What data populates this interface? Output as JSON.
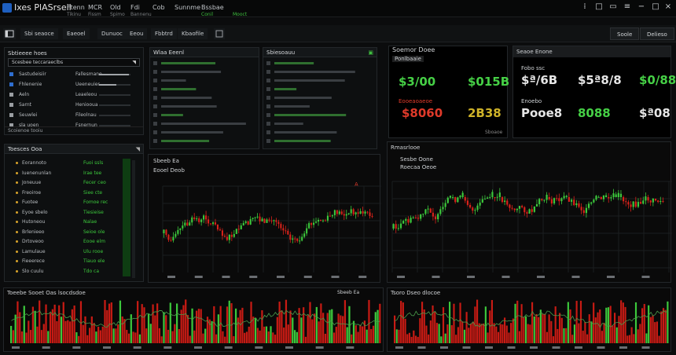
{
  "window": {
    "title": "Ixes PlASrseil",
    "menus": [
      "Ftenn",
      "MCR",
      "Old"
    ],
    "menus2": [
      "Fdi",
      "Cob",
      "Sunnme",
      "Bssbae"
    ],
    "sub": [
      "Tikinu",
      "Fissm",
      "Spimo",
      "Bannenu"
    ],
    "status": [
      "Conil",
      "Mooct"
    ]
  },
  "toolbar": {
    "items": [
      "Sbi seaoce",
      "Eaeoel",
      "Dunuoc",
      "Eeou",
      "Fbbtrd",
      "Kbaofile"
    ],
    "right": [
      "Soole",
      "Delieso"
    ]
  },
  "watchlist": {
    "title": "Sbtieeee hoes",
    "header": "Scesbee teccaraeclbs",
    "rows": [
      {
        "label": "Sastudeisiir",
        "value": "Fallesmane",
        "fill": 0.95
      },
      {
        "label": "Fhlenenie",
        "value": "Ueeneuier",
        "fill": 0.55
      },
      {
        "label": "Aeln",
        "value": "Leaeleou",
        "fill": 0.0
      },
      {
        "label": "Sarnt",
        "value": "Heniooua",
        "fill": 0.0
      },
      {
        "label": "Seuwlei",
        "value": "Fileolnau",
        "fill": 0.0
      },
      {
        "label": "sla uoen",
        "value": "Fsnernun",
        "fill": 0.0
      }
    ],
    "statusbar": "Scoienoe tooiu"
  },
  "positions": {
    "title": "Toesces Ooa",
    "rows": [
      {
        "label": "Eorannoto",
        "value": "Fuoi ssls"
      },
      {
        "label": "Iuenenunlan",
        "value": "Irae tee"
      },
      {
        "label": "Joneuue",
        "value": "Fecer ceo"
      },
      {
        "label": "Freoiroe",
        "value": "Siee cte"
      },
      {
        "label": "Fuotee",
        "value": "Fomoe rec"
      },
      {
        "label": "Eyoe sbelo",
        "value": "Tiesieise"
      },
      {
        "label": "Hutoneou",
        "value": "Nalae"
      },
      {
        "label": "Brlenieeo",
        "value": "Seioe ole"
      },
      {
        "label": "Drtoveoo",
        "value": "Eooe elm"
      },
      {
        "label": "Lamulaue",
        "value": "Ulu rooe"
      },
      {
        "label": "Fieeerece",
        "value": "Tiauo ele"
      },
      {
        "label": "Slo cuulu",
        "value": "Tdo ca"
      }
    ]
  },
  "orderbook": {
    "title": "Wlaa Eeenl",
    "title2": "Sbiesoauu"
  },
  "ticker1": {
    "title": "Soemor Doee",
    "label1": "Ponlbaaie",
    "big1": "$3/00",
    "big2": "$015B",
    "label2": "Eooeaoaeoe",
    "big3": "$8060",
    "big4": "2B38",
    "foot": "Sboaoe"
  },
  "ticker2": {
    "title": "Seaoe Enone",
    "label1": "Fobo ssc",
    "big1": "$ª/6B",
    "big2": "$5ª8/8",
    "big3": "$0/88",
    "label2": "Enoebo",
    "big4": "Pooe8",
    "big5": "8088",
    "big6": "$ª08"
  },
  "chart1": {
    "title": "Sbeeb  Ea",
    "sub": "Eooel Deob",
    "tag": "A"
  },
  "chart2": {
    "title": "Rmasrlooe",
    "sub1": "Sesbe Oone",
    "sub2": "Roecaa Oeoe"
  },
  "volume1": {
    "title": "Toeebe Sooet Oas lsocdsdoe",
    "tag": "Sbeeb  Ea"
  },
  "volume2": {
    "title": "Tsoro Dseo dlocoe"
  },
  "colors": {
    "up": "#3cc83c",
    "down": "#d8221a",
    "accent": "#1e5fbf"
  }
}
